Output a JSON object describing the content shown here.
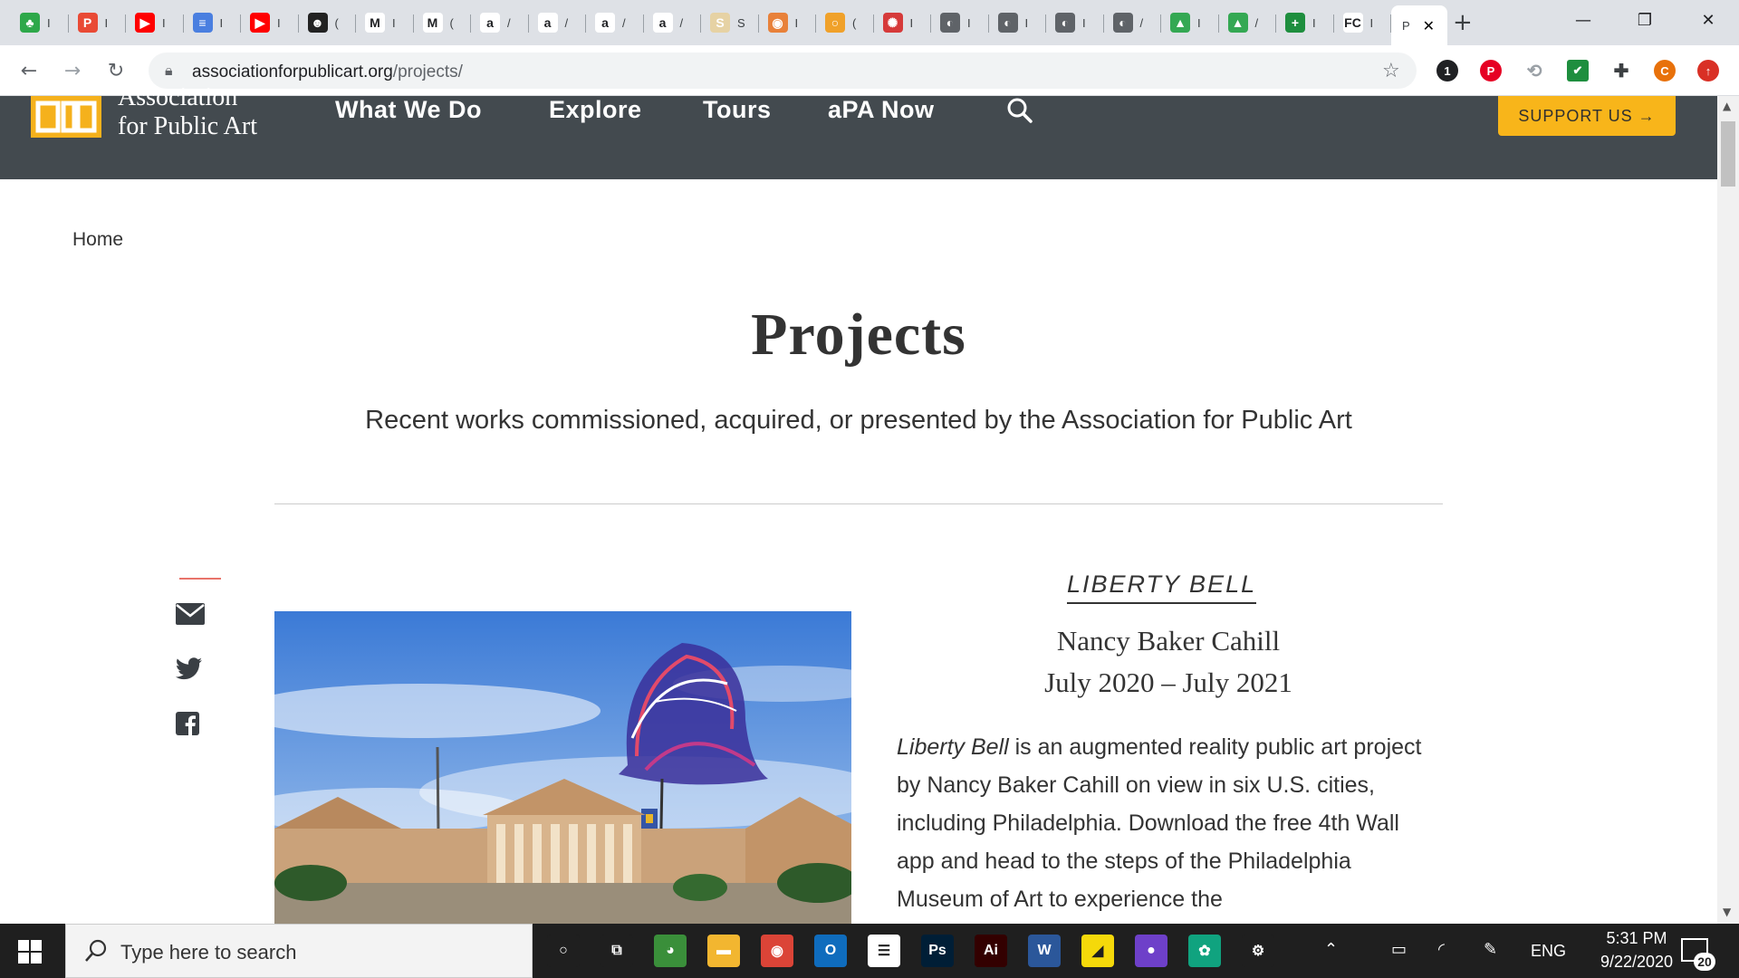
{
  "browser": {
    "tabs": [
      {
        "label": "I",
        "color": "#2ea84a",
        "glyph": "♣"
      },
      {
        "label": "I",
        "color": "#e94a35",
        "glyph": "P"
      },
      {
        "label": "I",
        "color": "#ff0000",
        "glyph": "▶"
      },
      {
        "label": "I",
        "color": "#4a7fe0",
        "glyph": "≡"
      },
      {
        "label": "I",
        "color": "#ff0000",
        "glyph": "▶"
      },
      {
        "label": "(",
        "color": "#222222",
        "glyph": "☻"
      },
      {
        "label": "I",
        "color": "#ffffff",
        "glyph": "M"
      },
      {
        "label": "(",
        "color": "#ffffff",
        "glyph": "M"
      },
      {
        "label": "/",
        "color": "#ffffff",
        "glyph": "a"
      },
      {
        "label": "/",
        "color": "#ffffff",
        "glyph": "a"
      },
      {
        "label": "/",
        "color": "#ffffff",
        "glyph": "a"
      },
      {
        "label": "/",
        "color": "#ffffff",
        "glyph": "a"
      },
      {
        "label": "S",
        "color": "#e6d2a4",
        "glyph": "S"
      },
      {
        "label": "I",
        "color": "#e8813a",
        "glyph": "◉"
      },
      {
        "label": "(",
        "color": "#f0a12a",
        "glyph": "○"
      },
      {
        "label": "I",
        "color": "#d63a3a",
        "glyph": "✺"
      },
      {
        "label": "I",
        "color": "#5f6368",
        "glyph": "◐"
      },
      {
        "label": "I",
        "color": "#5f6368",
        "glyph": "◐"
      },
      {
        "label": "I",
        "color": "#5f6368",
        "glyph": "◐"
      },
      {
        "label": "/",
        "color": "#5f6368",
        "glyph": "◐"
      },
      {
        "label": "I",
        "color": "#34a853",
        "glyph": "▲"
      },
      {
        "label": "/",
        "color": "#34a853",
        "glyph": "▲"
      },
      {
        "label": "I",
        "color": "#1e8e3e",
        "glyph": "+"
      },
      {
        "label": "I",
        "color": "#ffffff",
        "glyph": "FC"
      }
    ],
    "active_tab": {
      "label": "P",
      "close": "✕"
    },
    "new_tab": "+",
    "url_host": "associationforpublicart.org",
    "url_path": "/projects/",
    "window_controls": {
      "minimize": "—",
      "restore": "❐",
      "close": "✕"
    },
    "extensions": [
      {
        "name": "counter-badge",
        "label": "1",
        "color": "#202124"
      },
      {
        "name": "pinterest-icon",
        "label": "P",
        "color": "#e60023"
      },
      {
        "name": "ext-icon",
        "label": "⟲",
        "color": "#9aa0a6"
      },
      {
        "name": "check-icon",
        "label": "✔",
        "color": "#1e8e3e"
      },
      {
        "name": "puzzle-icon",
        "label": "✚",
        "color": "#3c4043"
      },
      {
        "name": "profile-avatar",
        "label": "C",
        "color": "#e8710a"
      },
      {
        "name": "update-icon",
        "label": "↑",
        "color": "#d93025"
      }
    ]
  },
  "site": {
    "logo_line1": "Association",
    "logo_line2": "for Public Art",
    "nav": [
      "What We Do",
      "Explore",
      "Tours",
      "aPA Now"
    ],
    "support": "SUPPORT US →",
    "breadcrumb": "Home",
    "title": "Projects",
    "subtitle": "Recent works commissioned, acquired, or presented by the Association for Public Art"
  },
  "project": {
    "title": "LIBERTY BELL",
    "artist": "Nancy Baker Cahill",
    "dates": "July 2020 – July 2021",
    "desc_italic": "Liberty Bell",
    "desc_rest": " is an augmented reality public art project by Nancy Baker Cahill on view in six U.S. cities, including Philadelphia. Download the free 4th Wall app and head to the steps of the Philadelphia Museum of Art to experience the"
  },
  "taskbar": {
    "search_placeholder": "Type here to search",
    "apps": [
      {
        "name": "cortana-icon",
        "glyph": "○",
        "color": "#1f1f1f"
      },
      {
        "name": "task-view-icon",
        "glyph": "⧉",
        "color": "#1f1f1f"
      },
      {
        "name": "app-green-icon",
        "glyph": "◕",
        "color": "#3a8f3a"
      },
      {
        "name": "file-explorer-icon",
        "glyph": "▬",
        "color": "#f2b630"
      },
      {
        "name": "chrome-icon",
        "glyph": "◉",
        "color": "#db4437"
      },
      {
        "name": "outlook-icon",
        "glyph": "O",
        "color": "#0f6cbd"
      },
      {
        "name": "app-white-icon",
        "glyph": "☰",
        "color": "#ffffff"
      },
      {
        "name": "photoshop-icon",
        "glyph": "Ps",
        "color": "#001e36"
      },
      {
        "name": "illustrator-icon",
        "glyph": "Ai",
        "color": "#330000"
      },
      {
        "name": "word-icon",
        "glyph": "W",
        "color": "#2b579a"
      },
      {
        "name": "sticky-notes-icon",
        "glyph": "◢",
        "color": "#f5d90a"
      },
      {
        "name": "github-icon",
        "glyph": "●",
        "color": "#6e40c9"
      },
      {
        "name": "chatgpt-icon",
        "glyph": "✿",
        "color": "#10a37f"
      },
      {
        "name": "settings-icon",
        "glyph": "⚙",
        "color": "#1f1f1f"
      }
    ],
    "lang": "ENG",
    "time": "5:31 PM",
    "date": "9/22/2020",
    "notifications": "20"
  }
}
